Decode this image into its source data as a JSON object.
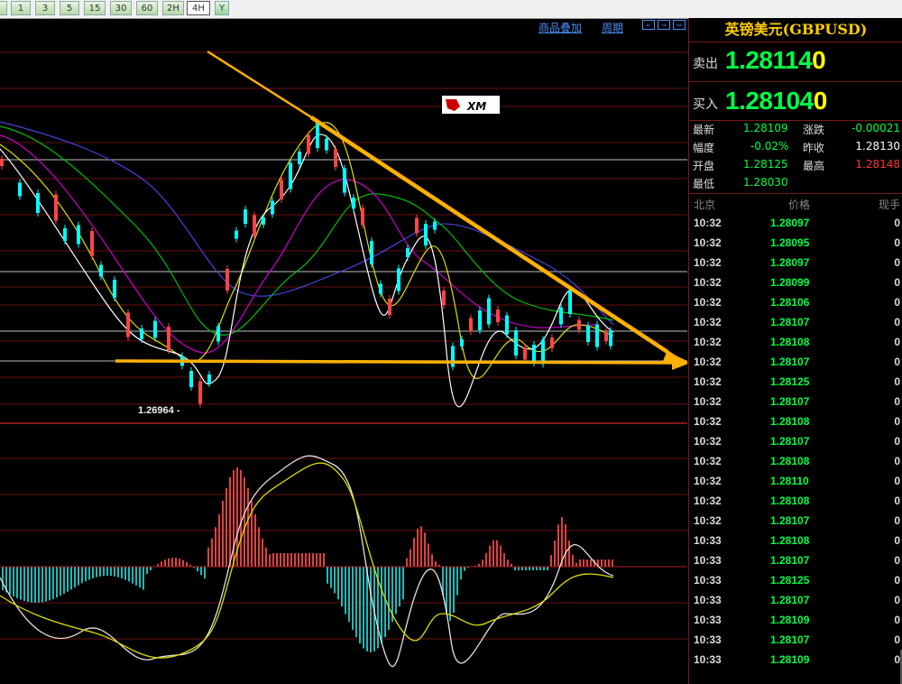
{
  "toolbar": {
    "buttons": [
      {
        "label": "1",
        "active": false
      },
      {
        "label": "3",
        "active": false
      },
      {
        "label": "5",
        "active": false
      },
      {
        "label": "15",
        "active": false
      },
      {
        "label": "30",
        "active": false
      },
      {
        "label": "60",
        "active": false
      },
      {
        "label": "2H",
        "active": false
      },
      {
        "label": "4H",
        "active": true
      },
      {
        "label": "Y",
        "active": false
      }
    ]
  },
  "chart_header": {
    "overlay_link": "商品叠加",
    "period_link": "周期"
  },
  "chart": {
    "low_label": "1.26964 -",
    "watermark": "XM"
  },
  "chart_data": {
    "type": "candlestick",
    "symbol": "GBPUSD",
    "timeframe": "4H",
    "annotations": {
      "low": 1.26964
    },
    "colors": {
      "up": "#ff4444",
      "down": "#00ffff",
      "trendline": "#ffb000",
      "ma1": "#ffffff",
      "ma2": "#ffff00",
      "ma3": "#ff00ff",
      "ma4": "#00cc00",
      "ma5": "#6666ff"
    }
  },
  "panel": {
    "title": "英镑美元(GBPUSD)",
    "sell_label": "卖出",
    "sell_price": "1.28114",
    "sell_size": "0",
    "buy_label": "买入",
    "buy_price": "1.28104",
    "buy_size": "0",
    "stats": {
      "latest_label": "最新",
      "latest": "1.28109",
      "change_label": "涨跌",
      "change": "-0.00021",
      "amp_label": "幅度",
      "amp": "-0.02%",
      "prev_label": "昨收",
      "prev": "1.28130",
      "open_label": "开盘",
      "open": "1.28125",
      "high_label": "最高",
      "high": "1.28148",
      "low_label": "最低",
      "low": "1.28030"
    },
    "ticks_header": {
      "time": "北京",
      "price": "价格",
      "vol": "现手"
    },
    "ticks": [
      {
        "time": "10:32",
        "price": "1.28097",
        "vol": "0"
      },
      {
        "time": "10:32",
        "price": "1.28095",
        "vol": "0"
      },
      {
        "time": "10:32",
        "price": "1.28097",
        "vol": "0"
      },
      {
        "time": "10:32",
        "price": "1.28099",
        "vol": "0"
      },
      {
        "time": "10:32",
        "price": "1.28106",
        "vol": "0"
      },
      {
        "time": "10:32",
        "price": "1.28107",
        "vol": "0"
      },
      {
        "time": "10:32",
        "price": "1.28108",
        "vol": "0"
      },
      {
        "time": "10:32",
        "price": "1.28107",
        "vol": "0"
      },
      {
        "time": "10:32",
        "price": "1.28125",
        "vol": "0"
      },
      {
        "time": "10:32",
        "price": "1.28107",
        "vol": "0"
      },
      {
        "time": "10:32",
        "price": "1.28108",
        "vol": "0"
      },
      {
        "time": "10:32",
        "price": "1.28107",
        "vol": "0"
      },
      {
        "time": "10:32",
        "price": "1.28108",
        "vol": "0"
      },
      {
        "time": "10:32",
        "price": "1.28110",
        "vol": "0"
      },
      {
        "time": "10:32",
        "price": "1.28108",
        "vol": "0"
      },
      {
        "time": "10:32",
        "price": "1.28107",
        "vol": "0"
      },
      {
        "time": "10:33",
        "price": "1.28108",
        "vol": "0"
      },
      {
        "time": "10:33",
        "price": "1.28107",
        "vol": "0"
      },
      {
        "time": "10:33",
        "price": "1.28125",
        "vol": "0"
      },
      {
        "time": "10:33",
        "price": "1.28107",
        "vol": "0"
      },
      {
        "time": "10:33",
        "price": "1.28109",
        "vol": "0"
      },
      {
        "time": "10:33",
        "price": "1.28107",
        "vol": "0"
      },
      {
        "time": "10:33",
        "price": "1.28109",
        "vol": "0"
      }
    ]
  }
}
